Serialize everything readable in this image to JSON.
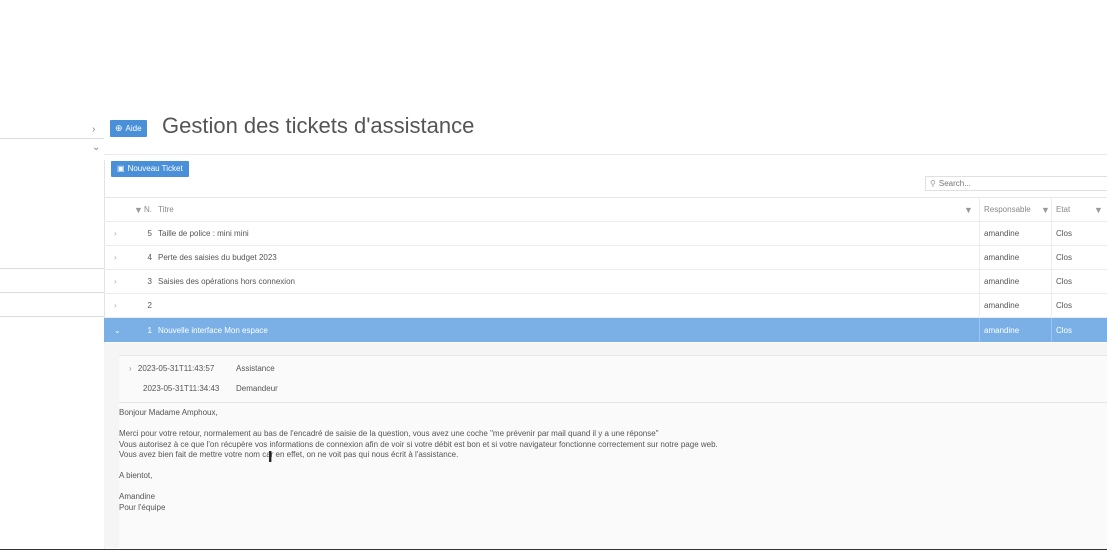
{
  "header": {
    "aide_label": "Aide",
    "title": "Gestion des tickets d'assistance"
  },
  "toolbar": {
    "new_ticket_label": "Nouveau Ticket",
    "search_placeholder": "Search..."
  },
  "grid": {
    "columns": {
      "n": "N.",
      "titre": "Titre",
      "responsable": "Responsable",
      "etat": "Etat"
    },
    "rows": [
      {
        "n": "5",
        "titre": "Taille de police : mini mini",
        "responsable": "amandine",
        "etat": "Clos"
      },
      {
        "n": "4",
        "titre": "Perte des saisies du budget 2023",
        "responsable": "amandine",
        "etat": "Clos"
      },
      {
        "n": "3",
        "titre": "Saisies des opérations hors connexion",
        "responsable": "amandine",
        "etat": "Clos"
      },
      {
        "n": "2",
        "titre": "",
        "responsable": "amandine",
        "etat": "Clos"
      },
      {
        "n": "1",
        "titre": "Nouvelle interface Mon espace",
        "responsable": "amandine",
        "etat": "Clos"
      }
    ],
    "selected_index": 4
  },
  "detail": {
    "messages": [
      {
        "date": "2023-05-31T11:43:57",
        "author": "Assistance"
      },
      {
        "date": "2023-05-31T11:34:43",
        "author": "Demandeur"
      }
    ],
    "body": [
      "Bonjour Madame Amphoux,",
      "",
      "Merci pour votre retour, normalement au bas de l'encadré de saisie de la question, vous avez une coche \"me prévenir par mail quand il y a une réponse\"",
      "Vous autorisez à ce que l'on récupère vos informations de connexion afin de voir si votre débit est bon et si votre navigateur fonctionne correctement sur notre page web.",
      "Vous avez bien fait de mettre votre nom car en effet, on ne voit pas qui nous écrit à l'assistance.",
      "",
      "A bientot,",
      "",
      "Amandine",
      "Pour l'équipe"
    ]
  },
  "icons": {
    "aide": "help-icon",
    "new_ticket": "new-document-icon",
    "search": "search-icon",
    "filter": "filter-icon",
    "expand": "chevron-right-icon",
    "collapse": "chevron-down-icon"
  },
  "colors": {
    "accent": "#4a90d9",
    "selected_row": "#7ab0e6"
  }
}
